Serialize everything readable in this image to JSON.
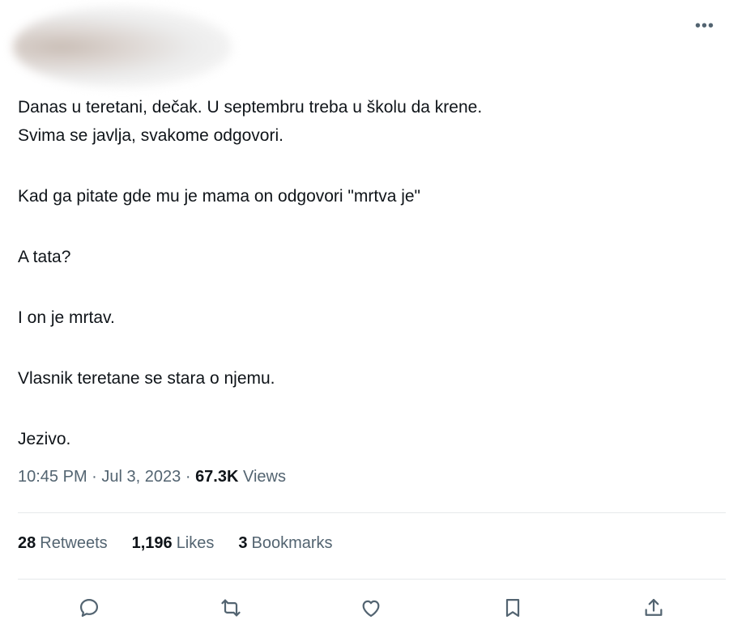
{
  "tweet": {
    "lines": [
      "Danas u teretani, dečak. U septembru treba u školu da krene.",
      "Svima se javlja, svakome odgovori.",
      "Kad ga pitate gde mu je mama on odgovori \"mrtva je\"",
      "A tata?",
      "I on je mrtav.",
      "Vlasnik teretane se stara o njemu.",
      "Jezivo."
    ]
  },
  "meta": {
    "time": "10:45 PM",
    "separator": "·",
    "date": "Jul 3, 2023",
    "views_count": "67.3K",
    "views_label": "Views"
  },
  "stats": {
    "retweets_count": "28",
    "retweets_label": "Retweets",
    "likes_count": "1,196",
    "likes_label": "Likes",
    "bookmarks_count": "3",
    "bookmarks_label": "Bookmarks"
  },
  "icons": {
    "more": "more-icon",
    "reply": "reply-icon",
    "retweet": "retweet-icon",
    "like": "heart-icon",
    "bookmark": "bookmark-icon",
    "share": "share-icon"
  },
  "colors": {
    "text": "#0f1419",
    "secondary": "#536471",
    "divider": "#e6e9eb"
  }
}
